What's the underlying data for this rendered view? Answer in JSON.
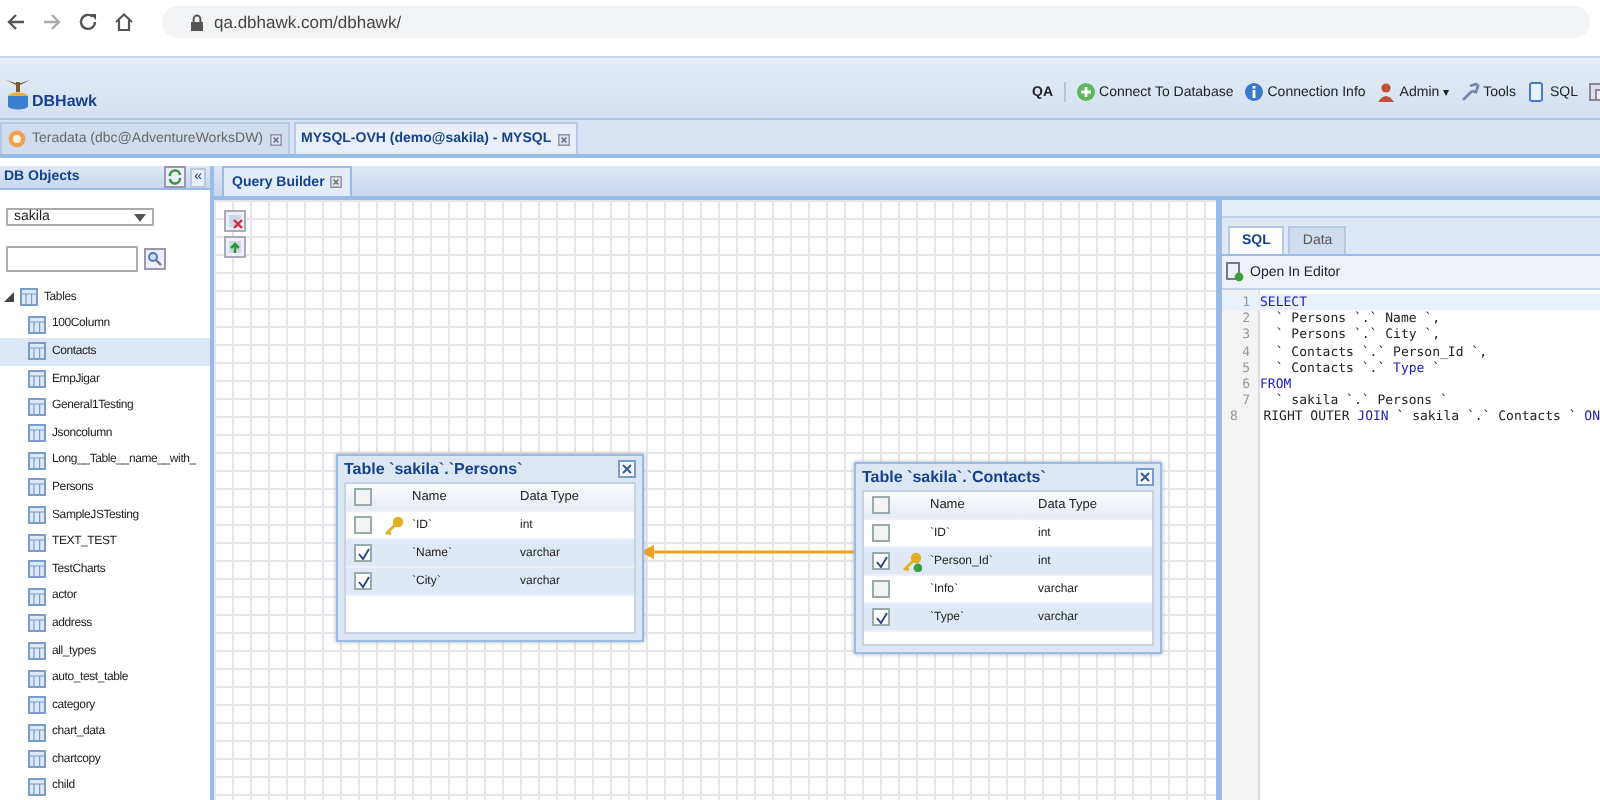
{
  "browser": {
    "url": "qa.dbhawk.com/dbhawk/"
  },
  "app": {
    "logo": "DBHawk",
    "toolbar": [
      {
        "kind": "text",
        "label": "QA"
      },
      {
        "kind": "connect",
        "label": "Connect To Database"
      },
      {
        "kind": "info",
        "label": "Connection Info"
      },
      {
        "kind": "admin",
        "label": "Admin",
        "dropdown": "▾"
      },
      {
        "kind": "tools",
        "label": "Tools"
      },
      {
        "kind": "sql",
        "label": "SQL"
      },
      {
        "kind": "more"
      }
    ]
  },
  "connection_tabs": [
    {
      "label": "Teradata (dbc@AdventureWorksDW)",
      "selected": false,
      "icon": true
    },
    {
      "label": "MYSQL-OVH (demo@sakila) - MYSQL",
      "selected": true,
      "icon": false
    }
  ],
  "sidebar": {
    "title": "DB Objects",
    "collapse": "«",
    "schema": "sakila",
    "tree": [
      {
        "label": "Tables",
        "expanded": true,
        "selected": false,
        "children": [
          {
            "label": "100Column",
            "selected": false
          },
          {
            "label": "Contacts",
            "selected": true
          },
          {
            "label": "EmpJigar",
            "selected": false
          },
          {
            "label": "General1Testing",
            "selected": false
          },
          {
            "label": "Jsoncolumn",
            "selected": false
          },
          {
            "label": "Long__Table__name__with_",
            "selected": false
          },
          {
            "label": "Persons",
            "selected": false
          },
          {
            "label": "SampleJSTesting",
            "selected": false
          },
          {
            "label": "TEXT_TEST",
            "selected": false
          },
          {
            "label": "TestCharts",
            "selected": false
          },
          {
            "label": "actor",
            "selected": false
          },
          {
            "label": "address",
            "selected": false
          },
          {
            "label": "all_types",
            "selected": false
          },
          {
            "label": "auto_test_table",
            "selected": false
          },
          {
            "label": "category",
            "selected": false
          },
          {
            "label": "chart_data",
            "selected": false
          },
          {
            "label": "chartcopy",
            "selected": false
          },
          {
            "label": "child",
            "selected": false
          }
        ]
      }
    ]
  },
  "main_tabs": [
    {
      "label": "Query Builder",
      "selected": true
    }
  ],
  "tables": [
    {
      "title": "Table `sakila`.`Persons`",
      "all_checked": false,
      "columns": [
        "Name",
        "Data Type"
      ],
      "rows": [
        {
          "checked": false,
          "kind": "primary_key",
          "name": "`ID`",
          "type": "int"
        },
        {
          "checked": true,
          "kind": "plain",
          "name": "`Name`",
          "type": "varchar"
        },
        {
          "checked": true,
          "kind": "plain",
          "name": "`City`",
          "type": "varchar"
        }
      ]
    },
    {
      "title": "Table `sakila`.`Contacts`",
      "all_checked": false,
      "columns": [
        "Name",
        "Data Type"
      ],
      "rows": [
        {
          "checked": false,
          "kind": "plain",
          "name": "`ID`",
          "type": "int"
        },
        {
          "checked": true,
          "kind": "foreign_key",
          "name": "`Person_Id`",
          "type": "int"
        },
        {
          "checked": false,
          "kind": "plain",
          "name": "`Info`",
          "type": "varchar"
        },
        {
          "checked": true,
          "kind": "plain",
          "name": "`Type`",
          "type": "varchar"
        }
      ]
    }
  ],
  "result_panel": {
    "tabs": [
      {
        "label": "SQL",
        "selected": true
      },
      {
        "label": "Data",
        "selected": false
      }
    ],
    "open_editor": "Open In Editor",
    "sql_lines": [
      {
        "number": "1",
        "segments": [
          {
            "kind": "keyword",
            "text": "SELECT"
          }
        ]
      },
      {
        "number": "2",
        "segments": [
          {
            "kind": "plain",
            "text": "  ` Persons `.` Name `,"
          }
        ]
      },
      {
        "number": "3",
        "segments": [
          {
            "kind": "plain",
            "text": "  ` Persons `.` City `,"
          }
        ]
      },
      {
        "number": "4",
        "segments": [
          {
            "kind": "plain",
            "text": "  ` Contacts `.` Person_Id `,"
          }
        ]
      },
      {
        "number": "5",
        "segments": [
          {
            "kind": "plain",
            "text": "  ` Contacts `.` "
          },
          {
            "kind": "keyword",
            "text": "Type"
          },
          {
            "kind": "plain",
            "text": " `"
          }
        ]
      },
      {
        "number": "6",
        "segments": [
          {
            "kind": "keyword",
            "text": "FROM"
          }
        ]
      },
      {
        "number": "7",
        "segments": [
          {
            "kind": "plain",
            "text": "  ` sakila `.` Persons `"
          }
        ]
      },
      {
        "number": "8",
        "segments": [
          {
            "kind": "plain",
            "text": "  RIGHT OUTER "
          },
          {
            "kind": "keyword",
            "text": "JOIN"
          },
          {
            "kind": "plain",
            "text": " ` sakila `.` Contacts ` "
          },
          {
            "kind": "keyword",
            "text": "ON"
          }
        ]
      }
    ]
  }
}
